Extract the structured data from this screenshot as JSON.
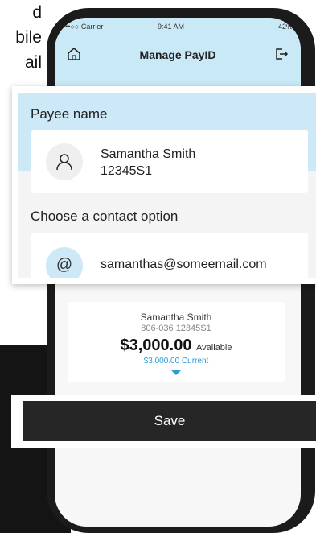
{
  "background_text": {
    "line1": "d",
    "line2": "bile",
    "line3": "ail"
  },
  "status_bar": {
    "carrier": "•••○○ Carrier",
    "time": "9:41 AM",
    "battery": "42%"
  },
  "header": {
    "title": "Manage PayID",
    "home_icon": "home-icon",
    "logout_icon": "logout-icon"
  },
  "payee": {
    "label": "Payee name",
    "name": "Samantha Smith",
    "account": "12345S1"
  },
  "contact": {
    "label": "Choose a contact option",
    "email": "samanthas@someemail.com",
    "icon": "@"
  },
  "account_card": {
    "name": "Samantha Smith",
    "number": "806-036 12345S1",
    "available_amount": "$3,000.00",
    "available_label": "Available",
    "current": "$3,000.00 Current"
  },
  "save_button": {
    "label": "Save"
  },
  "colors": {
    "header_bg": "#c9e9f7",
    "accent": "#2a9cd8",
    "button_bg": "#262626"
  }
}
